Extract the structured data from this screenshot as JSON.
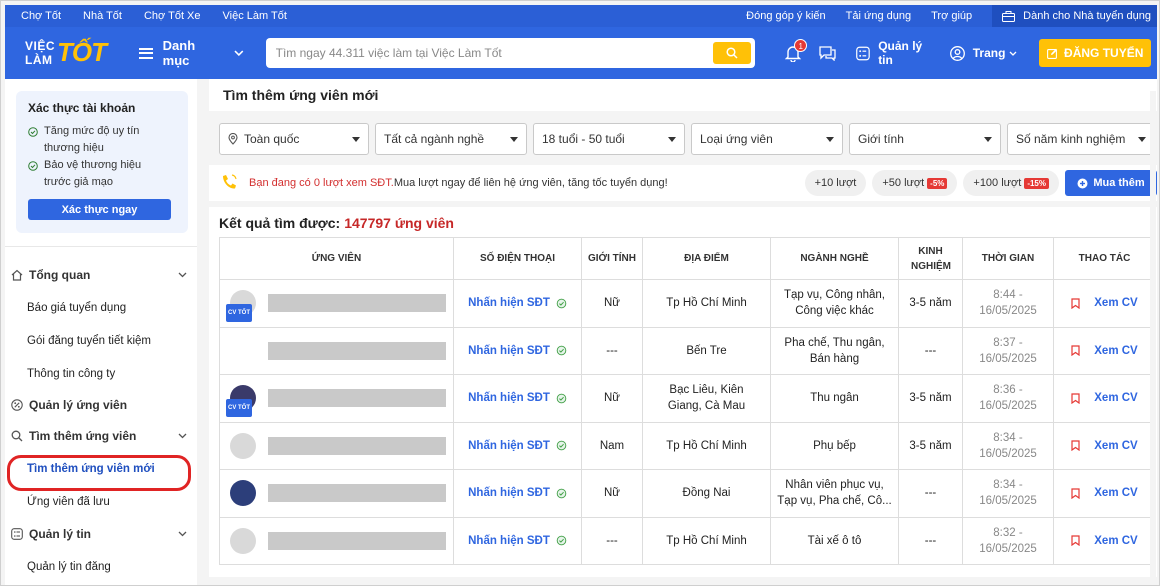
{
  "topbar": {
    "links": [
      "Chợ Tốt",
      "Nhà Tốt",
      "Chợ Tốt Xe",
      "Việc Làm Tốt"
    ],
    "right_links": [
      "Đóng góp ý kiến",
      "Tải ứng dụng",
      "Trợ giúp"
    ],
    "employer": "Dành cho Nhà tuyển dụng"
  },
  "header": {
    "logo_viec": "VIỆC",
    "logo_lam": "LÀM",
    "logo_tot": "TỐT",
    "menu_label": "Danh mục",
    "search_placeholder": "Tìm ngay 44.311 việc làm tại Việc Làm Tốt",
    "notification_count": "1",
    "manage_news": "Quản lý tin",
    "page_label": "Trang",
    "post_button": "ĐĂNG TUYỂN"
  },
  "sidebar": {
    "verify_title": "Xác thực tài khoản",
    "verify_items": [
      "Tăng mức độ uy tín thương hiệu",
      "Bảo vệ thương hiệu trước giả mạo"
    ],
    "verify_button": "Xác thực ngay",
    "overview": "Tổng quan",
    "overview_items": [
      "Báo giá tuyển dụng",
      "Gói đăng tuyển tiết kiệm",
      "Thông tin công ty"
    ],
    "manage_candidates": "Quản lý ứng viên",
    "find_candidates": "Tìm thêm ứng viên",
    "find_new": "Tìm thêm ứng viên mới",
    "saved": "Ứng viên đã lưu",
    "manage_news": "Quản lý tin",
    "manage_posts": "Quản lý tin đăng"
  },
  "main": {
    "title": "Tìm thêm ứng viên mới",
    "filters": [
      "Toàn quốc",
      "Tất cả ngành nghề",
      "18 tuổi - 50 tuổi",
      "Loại ứng viên",
      "Giới tính",
      "Số năm kinh nghiệm"
    ],
    "notice_warn": "Bạn đang có 0 lượt xem SĐT.",
    "notice_rest": " Mua lượt ngay để liên hệ ứng viên, tăng tốc tuyển dụng!",
    "pills": [
      {
        "label": "+10 lượt",
        "discount": ""
      },
      {
        "label": "+50 lượt",
        "discount": "-5%"
      },
      {
        "label": "+100 lượt",
        "discount": "-15%"
      }
    ],
    "buy_button": "Mua thêm",
    "results_label": "Kết quả tìm được:",
    "results_count": "147797 ứng viên"
  },
  "table": {
    "headers": [
      "ỨNG VIÊN",
      "SỐ ĐIỆN THOẠI",
      "GIỚI TÍNH",
      "ĐỊA ĐIỂM",
      "NGÀNH NGHỀ",
      "KINH NGHIỆM",
      "THỜI GIAN",
      "THAO TÁC"
    ],
    "cv_tag": "CV TỐT",
    "phone_label": "Nhấn hiện SĐT",
    "action_label": "Xem CV",
    "rows": [
      {
        "cv": true,
        "gender": "Nữ",
        "location": "Tp Hồ Chí Minh",
        "job": "Tạp vụ, Công nhân, Công việc khác",
        "exp": "3-5 năm",
        "time": "8:44 - 16/05/2025"
      },
      {
        "cv": false,
        "gender": "---",
        "location": "Bến Tre",
        "job": "Pha chế, Thu ngân, Bán hàng",
        "exp": "---",
        "time": "8:37 - 16/05/2025"
      },
      {
        "cv": true,
        "gender": "Nữ",
        "location": "Bạc Liêu, Kiên Giang, Cà Mau",
        "job": "Thu ngân",
        "exp": "3-5 năm",
        "time": "8:36 - 16/05/2025"
      },
      {
        "cv": false,
        "gender": "Nam",
        "location": "Tp Hồ Chí Minh",
        "job": "Phụ bếp",
        "exp": "3-5 năm",
        "time": "8:34 - 16/05/2025"
      },
      {
        "cv": false,
        "gender": "Nữ",
        "location": "Đồng Nai",
        "job": "Nhân viên phục vụ, Tạp vụ, Pha chế, Cô...",
        "exp": "---",
        "time": "8:34 - 16/05/2025"
      },
      {
        "cv": false,
        "gender": "---",
        "location": "Tp Hồ Chí Minh",
        "job": "Tài xế ô tô",
        "exp": "---",
        "time": "8:32 - 16/05/2025"
      }
    ]
  }
}
